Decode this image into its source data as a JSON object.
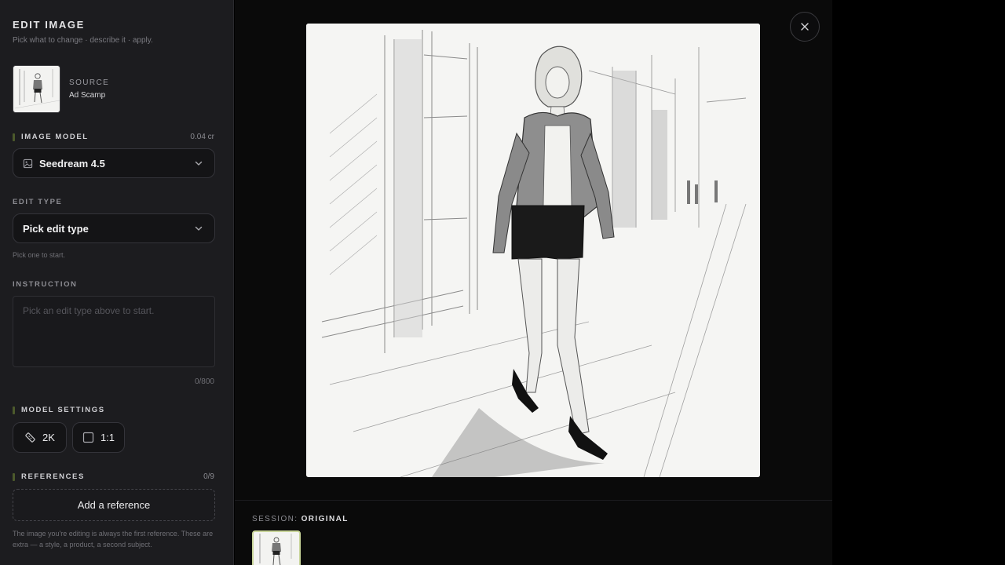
{
  "sidebar": {
    "title": "EDIT IMAGE",
    "subtitle": "Pick what to change · describe it · apply.",
    "source": {
      "label": "SOURCE",
      "name": "Ad Scamp"
    },
    "image_model": {
      "label": "IMAGE MODEL",
      "cost": "0.04 cr",
      "value": "Seedream 4.5"
    },
    "edit_type": {
      "label": "EDIT TYPE",
      "value": "Pick edit type",
      "hint": "Pick one to start."
    },
    "instruction": {
      "label": "INSTRUCTION",
      "placeholder": "Pick an edit type above to start.",
      "counter": "0/800"
    },
    "model_settings": {
      "label": "MODEL SETTINGS",
      "resolution": "2K",
      "aspect": "1:1"
    },
    "references": {
      "label": "REFERENCES",
      "count": "0/9",
      "add_label": "Add a reference",
      "note": "The image you're editing is always the first reference. These are extra — a style, a product, a second subject."
    }
  },
  "session": {
    "prefix": "SESSION:",
    "value": "ORIGINAL"
  },
  "icons": {
    "close": "close-icon",
    "chevron": "chevron-down-icon",
    "image": "image-icon",
    "resolution": "ruler-icon",
    "aspect": "square-icon"
  },
  "colors": {
    "accent_bar": "#4c5a2c",
    "thumb_border": "#c9d59a",
    "panel": "#1c1c1f",
    "background": "#0a0a0a"
  }
}
